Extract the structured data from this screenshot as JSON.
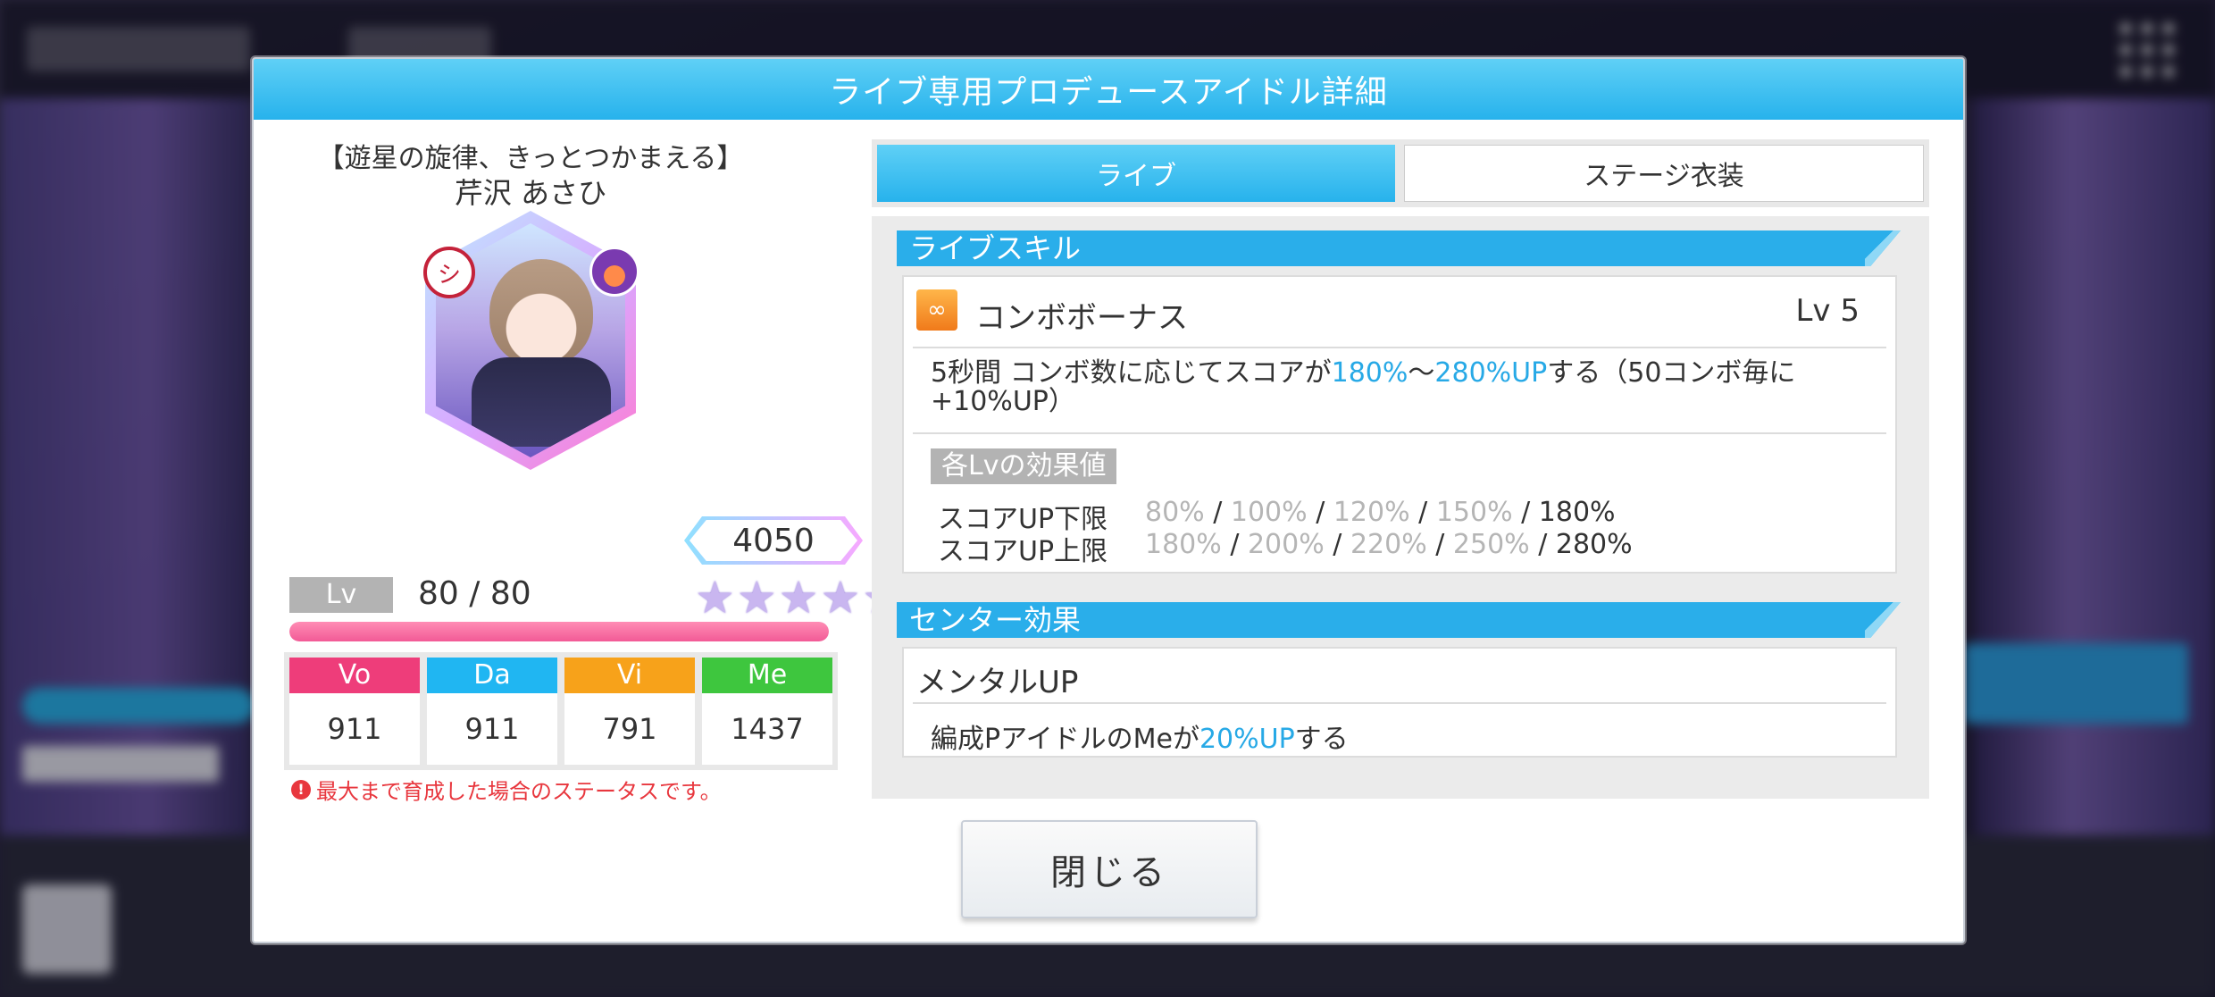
{
  "modal": {
    "title": "ライブ専用プロデュースアイドル詳細",
    "close_label": "閉じる"
  },
  "idol": {
    "card_title": "【遊星の旋律、きっとつかまえる】",
    "name": "芹沢 あさひ",
    "power": "4050",
    "stars": 5,
    "lv_label": "Lv",
    "lv_value": "80 / 80",
    "lv_progress": 1.0,
    "stats": [
      {
        "label": "Vo",
        "value": "911",
        "color": "#ee3d7a"
      },
      {
        "label": "Da",
        "value": "911",
        "color": "#20b6f2"
      },
      {
        "label": "Vi",
        "value": "791",
        "color": "#f7a21a"
      },
      {
        "label": "Me",
        "value": "1437",
        "color": "#3ec63e"
      }
    ],
    "note": "最大まで育成した場合のステータスです。"
  },
  "tabs": [
    {
      "label": "ライブ",
      "active": true
    },
    {
      "label": "ステージ衣装",
      "active": false
    }
  ],
  "live_skill": {
    "section_title": "ライブスキル",
    "name": "コンボボーナス",
    "level": "Lv 5",
    "desc_parts": [
      "5秒間 コンボ数に応じてスコアが",
      "180%",
      "〜",
      "280%UP",
      "する（50コンボ毎に",
      "+10%UP）"
    ],
    "lv_heading": "各Lvの効果値",
    "rows": [
      {
        "label": "スコアUP下限",
        "values": [
          "80%",
          "100%",
          "120%",
          "150%",
          "180%"
        ]
      },
      {
        "label": "スコアUP上限",
        "values": [
          "180%",
          "200%",
          "220%",
          "250%",
          "280%"
        ]
      }
    ]
  },
  "center_effect": {
    "section_title": "センター効果",
    "name": "メンタルUP",
    "desc_parts": [
      "編成Pアイドルの",
      "Me",
      "が",
      "20%UP",
      "する"
    ]
  },
  "colors": {
    "accent": "#27b2ec",
    "highlight": "#27a9e6",
    "warning": "#e8373e"
  }
}
